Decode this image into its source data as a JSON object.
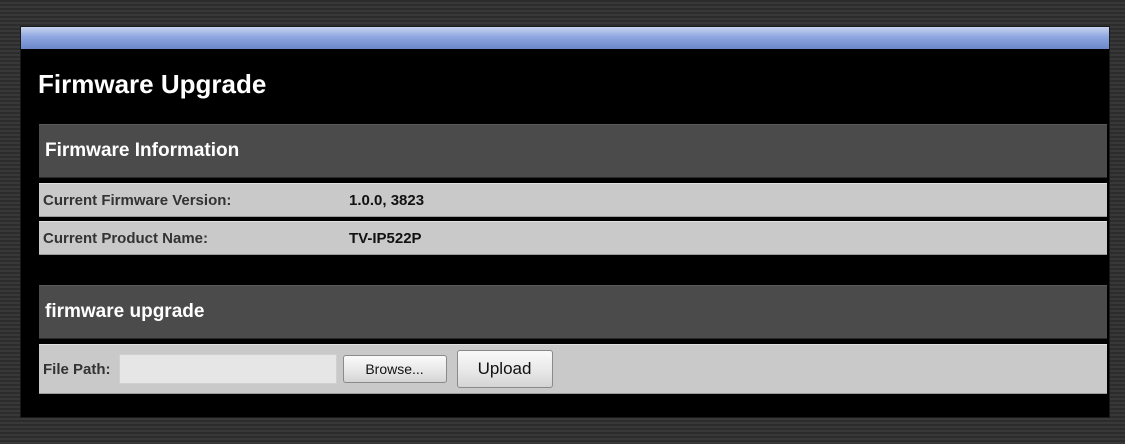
{
  "page": {
    "title": "Firmware Upgrade"
  },
  "firmware_info": {
    "header": "Firmware Information",
    "rows": [
      {
        "label": "Current Firmware Version:",
        "value": "1.0.0, 3823"
      },
      {
        "label": "Current Product Name:",
        "value": "TV-IP522P"
      }
    ]
  },
  "upgrade": {
    "header": "firmware upgrade",
    "file_path_label": "File Path:",
    "file_path_value": "",
    "browse_label": "Browse...",
    "upload_label": "Upload"
  }
}
